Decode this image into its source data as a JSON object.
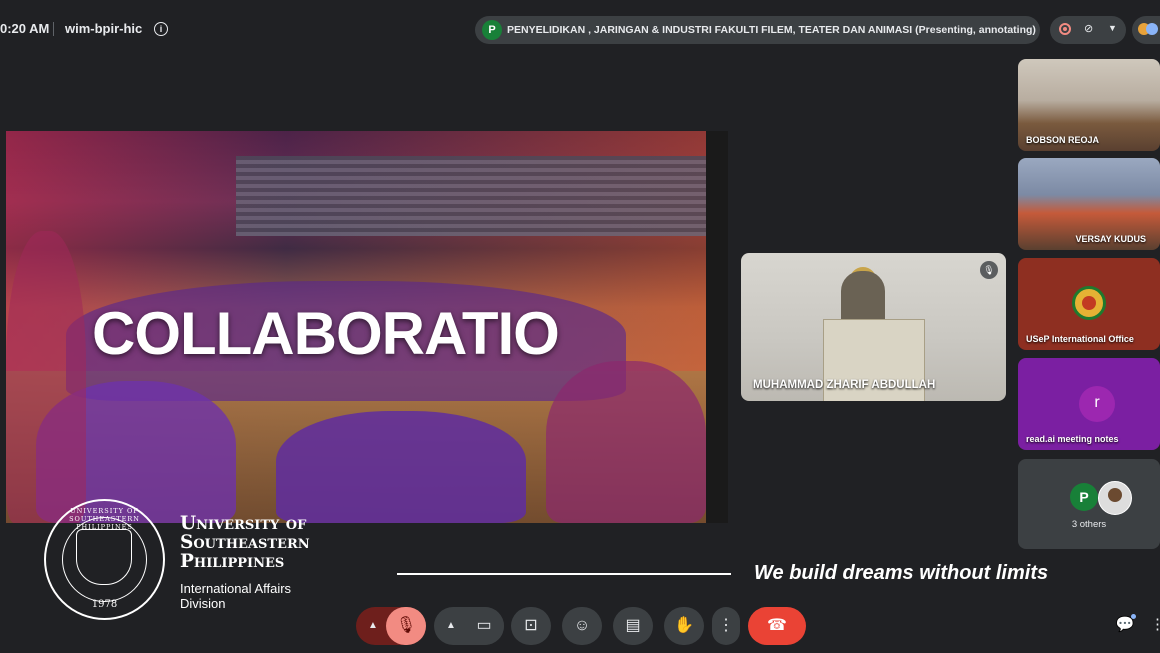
{
  "meeting": {
    "time": "0:20 AM",
    "code": "wim-bpir-hic",
    "presenter_initial": "P",
    "presenter_status": "PENYELIDIKAN , JARINGAN & INDUSTRI FAKULTI FILEM, TEATER DAN ANIMASI (Presenting, annotating)"
  },
  "slide": {
    "headline": "COLLABORATIO"
  },
  "participants": {
    "speaker": "MUHAMMAD ZHARIF ABDULLAH",
    "tiles": [
      {
        "name": "BOBSON REOJA"
      },
      {
        "name": "VERSAY KUDUS"
      },
      {
        "name": "USeP International Office"
      },
      {
        "name": "read.ai meeting notes",
        "initial": "r"
      },
      {
        "name": "3 others",
        "initial": "P"
      }
    ]
  },
  "branding": {
    "seal_ring_text": "UNIVERSITY OF SOUTHEASTERN PHILIPPINES",
    "seal_year": "1978",
    "university_line1": "University of",
    "university_line2": "Southeastern",
    "university_line3": "Philippines",
    "division": "International Affairs Division",
    "tagline": "We build dreams without limits"
  },
  "controls": {
    "mic_icon": "mic-off-icon",
    "camera_icon": "camera-icon",
    "present_icon": "present-icon",
    "reactions_icon": "emoji-icon",
    "captions_icon": "captions-icon",
    "hand_icon": "raise-hand-icon",
    "more_icon": "more-vert-icon",
    "leave_icon": "end-call-icon"
  },
  "colors": {
    "background": "#202124",
    "leave": "#ea4335",
    "mic_off": "#f28b82",
    "presenter_avatar": "#188038",
    "read_ai": "#7b1fa2",
    "usep_tile": "#8e2f21"
  }
}
